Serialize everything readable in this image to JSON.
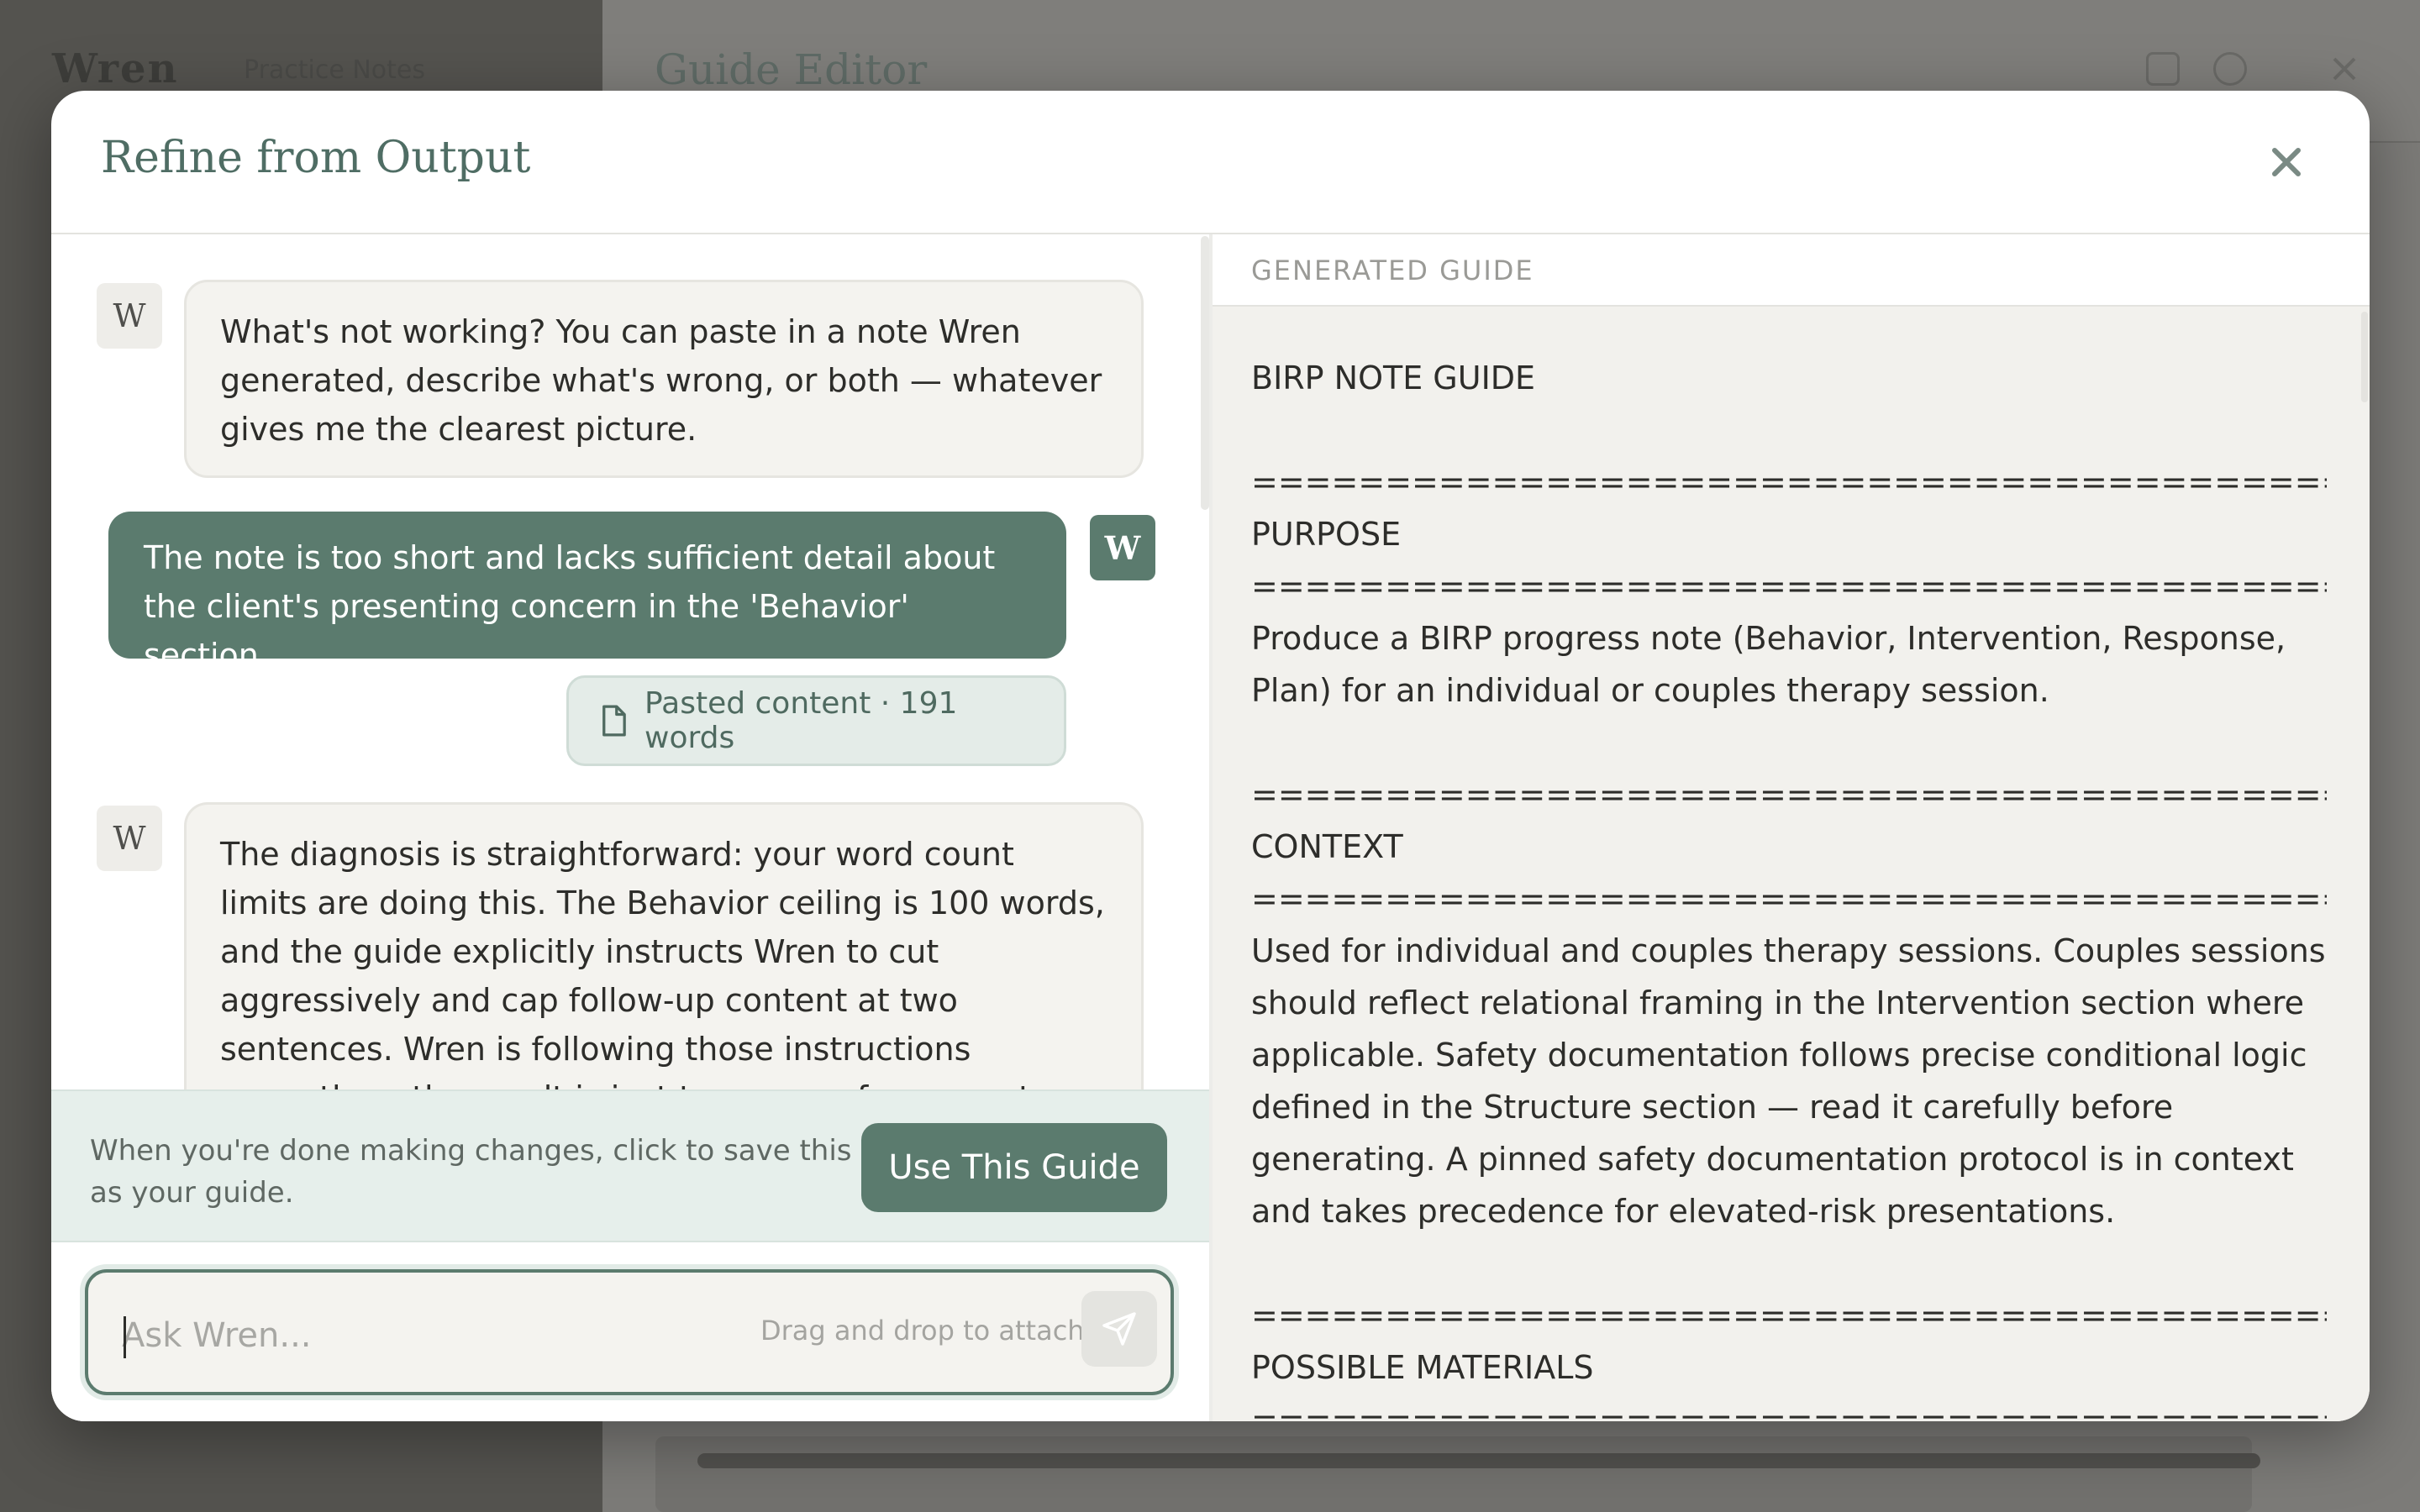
{
  "background": {
    "logo": "Wren",
    "logo_sub": "Practice Notes",
    "page_title": "Guide Editor"
  },
  "modal": {
    "title": "Refine from Output",
    "close_icon": "close-icon"
  },
  "chat": {
    "assistant_avatar": "W",
    "user_avatar": "W",
    "messages": [
      {
        "role": "assistant",
        "text": "What's not working? You can paste in a note Wren generated, describe what's wrong, or both — whatever gives me the clearest picture."
      },
      {
        "role": "user",
        "text": "The note is too short and lacks sufficient detail about the client's presenting concern in the 'Behavior' section."
      },
      {
        "role": "assistant",
        "text": "The diagnosis is straightforward: your word count limits are doing this. The Behavior ceiling is 100 words, and the guide explicitly instructs Wren to cut aggressively and cap follow-up content at two sentences. Wren is following those instructions correctly — the result is just too sparse for accurate clinical reference."
      }
    ],
    "attachment": {
      "icon": "document-icon",
      "label": "Pasted content · 191 words"
    }
  },
  "save_bar": {
    "text": "When you're done making changes, click to save this as your guide.",
    "button_label": "Use This Guide"
  },
  "input": {
    "placeholder": "Ask Wren...",
    "drag_hint": "Drag and drop to attach",
    "send_icon": "send-icon"
  },
  "guide": {
    "header": "GENERATED GUIDE",
    "content": "BIRP NOTE GUIDE\n\n================================================\nPURPOSE\n================================================\nProduce a BIRP progress note (Behavior, Intervention, Response, Plan) for an individual or couples therapy session.\n\n================================================\nCONTEXT\n================================================\nUsed for individual and couples therapy sessions. Couples sessions should reflect relational framing in the Intervention section where applicable. Safety documentation follows precise conditional logic defined in the Structure section — read it carefully before generating. A pinned safety documentation protocol is in context and takes precedence for elevated-risk presentations.\n\n================================================\nPOSSIBLE MATERIALS\n================================================"
  },
  "colors": {
    "accent": "#5b7b6e",
    "accent_light": "#e6efeb",
    "panel_bg": "#f2f1ed"
  }
}
